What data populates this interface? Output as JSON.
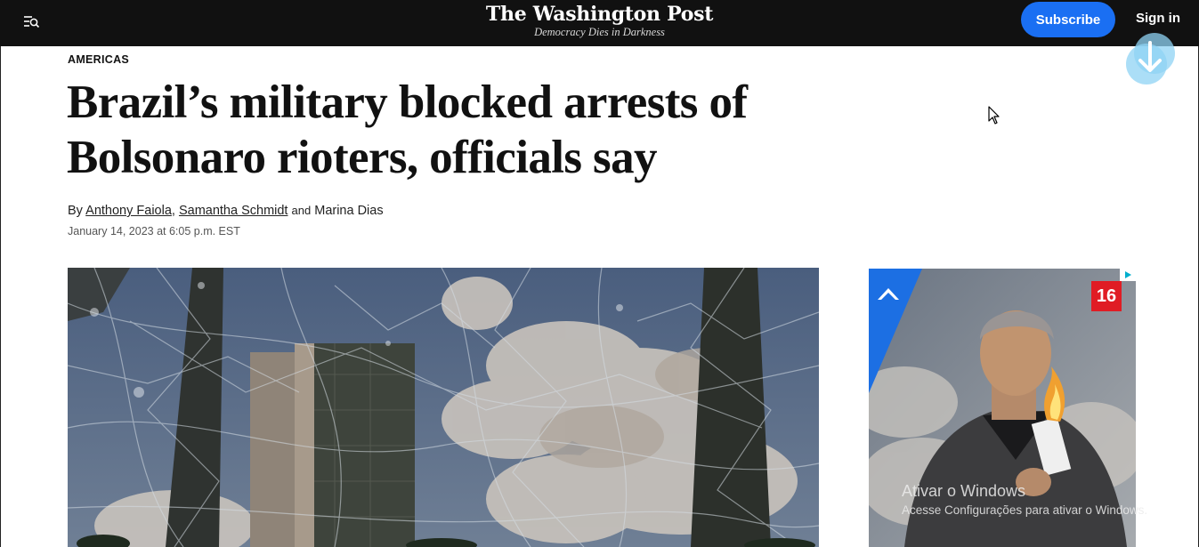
{
  "header": {
    "logo": "The Washington Post",
    "tagline": "Democracy Dies in Darkness",
    "subscribe_label": "Subscribe",
    "signin_label": "Sign in",
    "menu_icon": "menu-search-icon"
  },
  "article": {
    "kicker": "AMERICAS",
    "headline_line1": "Brazil’s military blocked arrests of",
    "headline_line2": "Bolsonaro rioters, officials say",
    "byline": {
      "prefix": "By",
      "author1": "Anthony Faiola",
      "separator": ",",
      "author2": "Samantha Schmidt",
      "conjunction": "and",
      "author3": "Marina Dias"
    },
    "date": "January 14, 2023 at 6:05 p.m. EST"
  },
  "ad": {
    "age_rating": "16",
    "choice_icon": "adchoices-icon"
  },
  "watermark": {
    "title": "Ativar o Windows",
    "subtitle": "Acesse Configurações para ativar o Windows."
  },
  "colors": {
    "topbar": "#111111",
    "subscribe": "#1a6ff3",
    "download_icon": "#8fd3f4"
  }
}
